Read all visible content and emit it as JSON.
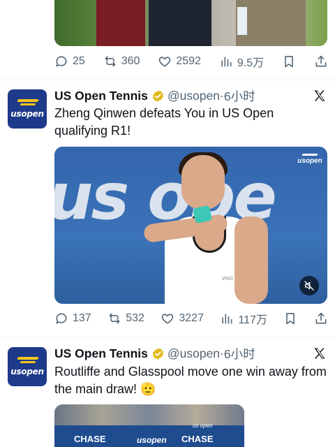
{
  "tweet_prev": {
    "actions": {
      "replies": "25",
      "retweets": "360",
      "likes": "2592",
      "views": "9.5万"
    }
  },
  "tweet1": {
    "avatar_text": "usopen",
    "name": "US Open Tennis",
    "handle": "@usopen",
    "separator": "·",
    "time": "6小时",
    "text": "Zheng Qinwen defeats You in US Open qualifying R1!",
    "media": {
      "wall_text": "us ope",
      "watermark": "usopen",
      "shirt_brand": "vivo"
    },
    "actions": {
      "replies": "137",
      "retweets": "532",
      "likes": "3227",
      "views": "117万"
    }
  },
  "tweet2": {
    "avatar_text": "usopen",
    "name": "US Open Tennis",
    "handle": "@usopen",
    "separator": "·",
    "time": "6小时",
    "text": "Routliffe and Glasspool move one win away from the main draw! 🫡",
    "media": {
      "sponsor_left": "CHASE",
      "logo": "usopen",
      "sponsor_right": "CHASE",
      "logo_small": "us open"
    }
  },
  "colors": {
    "accent": "#1d9bf0",
    "secondary_text": "#536471",
    "verified": "#e2b719",
    "brand_blue": "#1e3a8a"
  },
  "icons": [
    "reply-icon",
    "retweet-icon",
    "like-icon",
    "views-icon",
    "bookmark-icon",
    "share-icon",
    "verified-badge-icon",
    "x-logo-icon",
    "mute-icon"
  ]
}
